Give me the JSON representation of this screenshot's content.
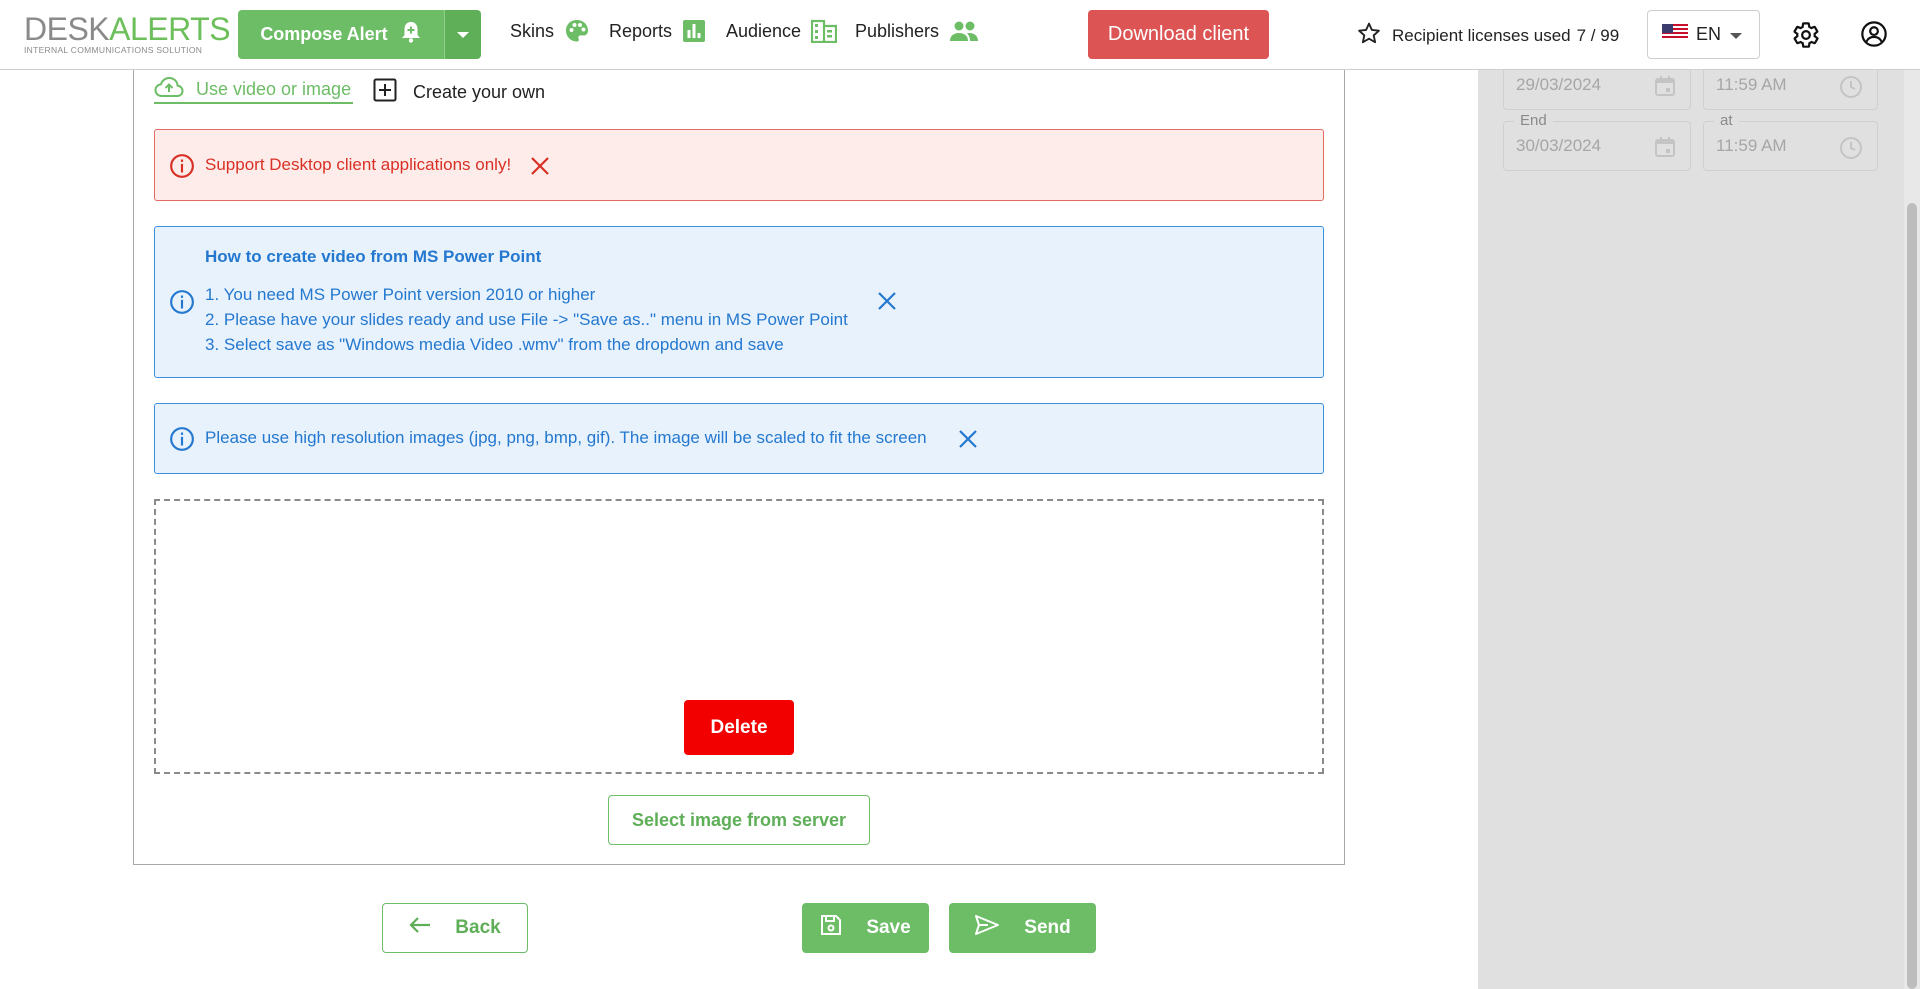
{
  "header": {
    "logo": {
      "brand_part1": "DESK",
      "brand_part2": "ALERTS",
      "tagline": "INTERNAL COMMUNICATIONS SOLUTION"
    },
    "compose": {
      "label": "Compose Alert",
      "icon": "bell-plus-icon",
      "menu_icon": "caret-down-icon"
    },
    "nav": [
      {
        "label": "Skins",
        "icon": "palette-icon"
      },
      {
        "label": "Reports",
        "icon": "bar-chart-icon"
      },
      {
        "label": "Audience",
        "icon": "building-icon"
      },
      {
        "label": "Publishers",
        "icon": "people-icon"
      }
    ],
    "download_label": "Download client",
    "licenses": {
      "label": "Recipient licenses used",
      "value": "7 / 99",
      "icon": "star-outline-icon"
    },
    "language": {
      "code": "EN",
      "flag": "us-flag-icon"
    },
    "settings_icon": "gear-icon",
    "account_icon": "user-circle-icon"
  },
  "schedule": {
    "start_date": "29/03/2024",
    "start_time": "11:59 AM",
    "end_label": "End",
    "end_date": "30/03/2024",
    "at_label": "at",
    "end_time": "11:59 AM"
  },
  "media_tabs": {
    "video_label": "Use video or image",
    "own_label": "Create your own"
  },
  "alerts": {
    "desktop_only": "Support Desktop client applications only!",
    "howto_title": "How to create video from MS Power Point",
    "howto_steps": [
      "1. You need MS Power Point version 2010 or higher",
      "2. Please have your slides ready and use File -> \"Save as..\" menu in MS Power Point",
      "3. Select save as \"Windows media Video .wmv\" from the dropdown and save"
    ],
    "resolution": "Please use high resolution images (jpg, png, bmp, gif). The image will be scaled to fit the screen"
  },
  "upload": {
    "delete_label": "Delete",
    "select_label": "Select image from server"
  },
  "footer": {
    "back_label": "Back",
    "save_label": "Save",
    "send_label": "Send"
  },
  "colors": {
    "brand_green": "#6cbd66",
    "download_red": "#dc5454",
    "delete_red": "#f20000",
    "info_blue": "#2478cf",
    "error_red": "#d93025"
  }
}
